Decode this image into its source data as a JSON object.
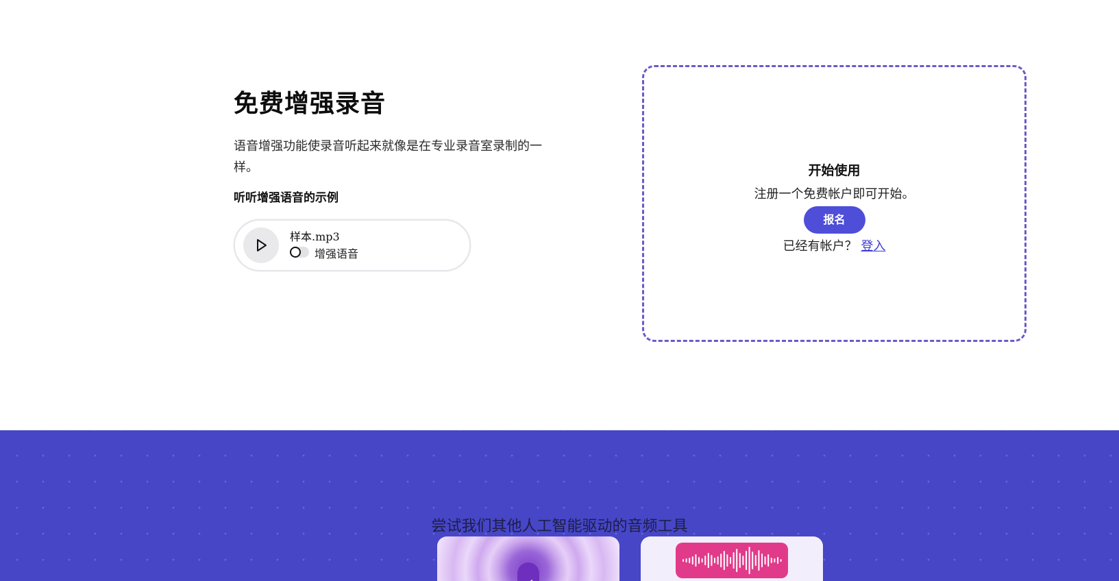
{
  "hero": {
    "title": "免费增强录音",
    "description": "语音增强功能使录音听起来就像是在专业录音室录制的一样。",
    "sample_heading": "听听增强语音的示例"
  },
  "player": {
    "file_name": "样本.mp3",
    "toggle_label": "增强语音",
    "toggle_on": false
  },
  "signup": {
    "title": "开始使用",
    "subtitle": "注册一个免费帐户即可开始。",
    "button_label": "报名",
    "login_prompt": "已经有帐户？",
    "login_link": "登入"
  },
  "tools": {
    "heading": "尝试我们其他人工智能驱动的音频工具",
    "cards": [
      {
        "icon": "voice-check-icon"
      },
      {
        "icon": "waveform-icon"
      }
    ]
  },
  "colors": {
    "accent": "#4e4ed9",
    "band": "#4646c7",
    "dashed_border": "#6a5ac8",
    "waveform_bg": "#e23a8a"
  }
}
